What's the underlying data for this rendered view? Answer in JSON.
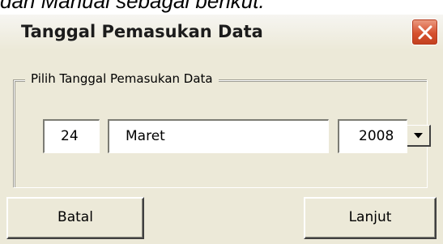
{
  "background_text": "dan Manual sebagai berikut.",
  "dialog": {
    "title": "Tanggal Pemasukan Data",
    "close_icon": "close-x-icon"
  },
  "group": {
    "legend": "Pilih Tanggal Pemasukan Data",
    "day": "24",
    "month": "Maret",
    "year": "2008",
    "dropdown_icon": "chevron-down-icon"
  },
  "buttons": {
    "cancel_label": "Batal",
    "next_label": "Lanjut"
  },
  "colors": {
    "dialog_bg": "#ece9d8",
    "close_button": "#d6512f"
  }
}
